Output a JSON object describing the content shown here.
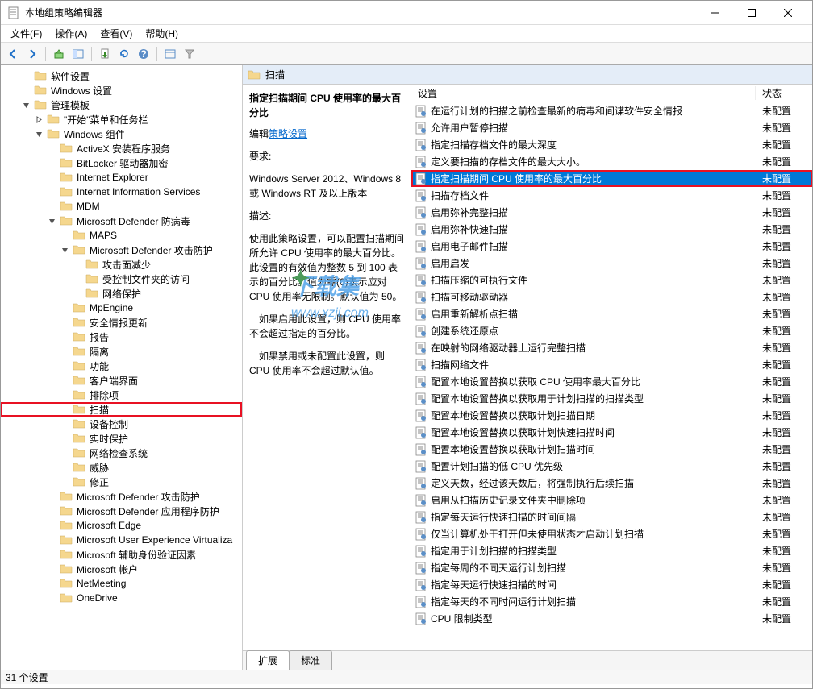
{
  "window": {
    "title": "本地组策略编辑器"
  },
  "menu": [
    "文件(F)",
    "操作(A)",
    "查看(V)",
    "帮助(H)"
  ],
  "tree": [
    {
      "d": 1,
      "exp": null,
      "label": "软件设置"
    },
    {
      "d": 1,
      "exp": null,
      "label": "Windows 设置"
    },
    {
      "d": 1,
      "exp": "open",
      "label": "管理模板"
    },
    {
      "d": 2,
      "exp": "closed",
      "label": "\"开始\"菜单和任务栏"
    },
    {
      "d": 2,
      "exp": "open",
      "label": "Windows 组件"
    },
    {
      "d": 3,
      "exp": null,
      "label": "ActiveX 安装程序服务"
    },
    {
      "d": 3,
      "exp": null,
      "label": "BitLocker 驱动器加密"
    },
    {
      "d": 3,
      "exp": null,
      "label": "Internet Explorer"
    },
    {
      "d": 3,
      "exp": null,
      "label": "Internet Information Services"
    },
    {
      "d": 3,
      "exp": null,
      "label": "MDM"
    },
    {
      "d": 3,
      "exp": "open",
      "label": "Microsoft Defender 防病毒"
    },
    {
      "d": 4,
      "exp": null,
      "label": "MAPS"
    },
    {
      "d": 4,
      "exp": "open",
      "label": "Microsoft Defender 攻击防护"
    },
    {
      "d": 5,
      "exp": null,
      "label": "攻击面减少"
    },
    {
      "d": 5,
      "exp": null,
      "label": "受控制文件夹的访问"
    },
    {
      "d": 5,
      "exp": null,
      "label": "网络保护"
    },
    {
      "d": 4,
      "exp": null,
      "label": "MpEngine"
    },
    {
      "d": 4,
      "exp": null,
      "label": "安全情报更新"
    },
    {
      "d": 4,
      "exp": null,
      "label": "报告"
    },
    {
      "d": 4,
      "exp": null,
      "label": "隔离"
    },
    {
      "d": 4,
      "exp": null,
      "label": "功能"
    },
    {
      "d": 4,
      "exp": null,
      "label": "客户端界面"
    },
    {
      "d": 4,
      "exp": null,
      "label": "排除项"
    },
    {
      "d": 4,
      "exp": null,
      "label": "扫描",
      "hl": true
    },
    {
      "d": 4,
      "exp": null,
      "label": "设备控制"
    },
    {
      "d": 4,
      "exp": null,
      "label": "实时保护"
    },
    {
      "d": 4,
      "exp": null,
      "label": "网络检查系统"
    },
    {
      "d": 4,
      "exp": null,
      "label": "威胁"
    },
    {
      "d": 4,
      "exp": null,
      "label": "修正"
    },
    {
      "d": 3,
      "exp": null,
      "label": "Microsoft Defender 攻击防护"
    },
    {
      "d": 3,
      "exp": null,
      "label": "Microsoft Defender 应用程序防护"
    },
    {
      "d": 3,
      "exp": null,
      "label": "Microsoft Edge"
    },
    {
      "d": 3,
      "exp": null,
      "label": "Microsoft User Experience Virtualiza"
    },
    {
      "d": 3,
      "exp": null,
      "label": "Microsoft 辅助身份验证因素"
    },
    {
      "d": 3,
      "exp": null,
      "label": "Microsoft 帐户"
    },
    {
      "d": 3,
      "exp": null,
      "label": "NetMeeting"
    },
    {
      "d": 3,
      "exp": null,
      "label": "OneDrive"
    }
  ],
  "header": {
    "title": "扫描"
  },
  "detail": {
    "title": "指定扫描期间 CPU 使用率的最大百分比",
    "editLabel": "编辑",
    "editLink": "策略设置",
    "reqLabel": "要求:",
    "reqText": "Windows Server 2012、Windows 8 或 Windows RT 及以上版本",
    "descLabel": "描述:",
    "desc1": "使用此策略设置，可以配置扫描期间所允许 CPU 使用率的最大百分比。此设置的有效值为整数 5 到 100 表示的百分比。值为零(0)表示应对 CPU 使用率无限制。默认值为 50。",
    "desc2": "如果启用此设置，则 CPU 使用率不会超过指定的百分比。",
    "desc3": "如果禁用或未配置此设置，则 CPU 使用率不会超过默认值。"
  },
  "columns": {
    "c1": "设置",
    "c2": "状态"
  },
  "rows": [
    {
      "t": "在运行计划的扫描之前检查最新的病毒和间谍软件安全情报",
      "s": "未配置"
    },
    {
      "t": "允许用户暂停扫描",
      "s": "未配置"
    },
    {
      "t": "指定扫描存档文件的最大深度",
      "s": "未配置"
    },
    {
      "t": "定义要扫描的存档文件的最大大小。",
      "s": "未配置"
    },
    {
      "t": "指定扫描期间 CPU 使用率的最大百分比",
      "s": "未配置",
      "sel": true
    },
    {
      "t": "扫描存档文件",
      "s": "未配置"
    },
    {
      "t": "启用弥补完整扫描",
      "s": "未配置"
    },
    {
      "t": "启用弥补快速扫描",
      "s": "未配置"
    },
    {
      "t": "启用电子邮件扫描",
      "s": "未配置"
    },
    {
      "t": "启用启发",
      "s": "未配置"
    },
    {
      "t": "扫描压缩的可执行文件",
      "s": "未配置"
    },
    {
      "t": "扫描可移动驱动器",
      "s": "未配置"
    },
    {
      "t": "启用重新解析点扫描",
      "s": "未配置"
    },
    {
      "t": "创建系统还原点",
      "s": "未配置"
    },
    {
      "t": "在映射的网络驱动器上运行完整扫描",
      "s": "未配置"
    },
    {
      "t": "扫描网络文件",
      "s": "未配置"
    },
    {
      "t": "配置本地设置替换以获取 CPU 使用率最大百分比",
      "s": "未配置"
    },
    {
      "t": "配置本地设置替换以获取用于计划扫描的扫描类型",
      "s": "未配置"
    },
    {
      "t": "配置本地设置替换以获取计划扫描日期",
      "s": "未配置"
    },
    {
      "t": "配置本地设置替换以获取计划快速扫描时间",
      "s": "未配置"
    },
    {
      "t": "配置本地设置替换以获取计划扫描时间",
      "s": "未配置"
    },
    {
      "t": "配置计划扫描的低 CPU 优先级",
      "s": "未配置"
    },
    {
      "t": "定义天数，经过该天数后，将强制执行后续扫描",
      "s": "未配置"
    },
    {
      "t": "启用从扫描历史记录文件夹中删除项",
      "s": "未配置"
    },
    {
      "t": "指定每天运行快速扫描的时间间隔",
      "s": "未配置"
    },
    {
      "t": "仅当计算机处于打开但未使用状态才启动计划扫描",
      "s": "未配置"
    },
    {
      "t": "指定用于计划扫描的扫描类型",
      "s": "未配置"
    },
    {
      "t": "指定每周的不同天运行计划扫描",
      "s": "未配置"
    },
    {
      "t": "指定每天运行快速扫描的时间",
      "s": "未配置"
    },
    {
      "t": "指定每天的不同时间运行计划扫描",
      "s": "未配置"
    },
    {
      "t": "CPU 限制类型",
      "s": "未配置"
    }
  ],
  "tabs": {
    "t1": "扩展",
    "t2": "标准"
  },
  "status": "31 个设置",
  "watermark": {
    "txt": "下载集",
    "url": "www.xzji.com"
  }
}
